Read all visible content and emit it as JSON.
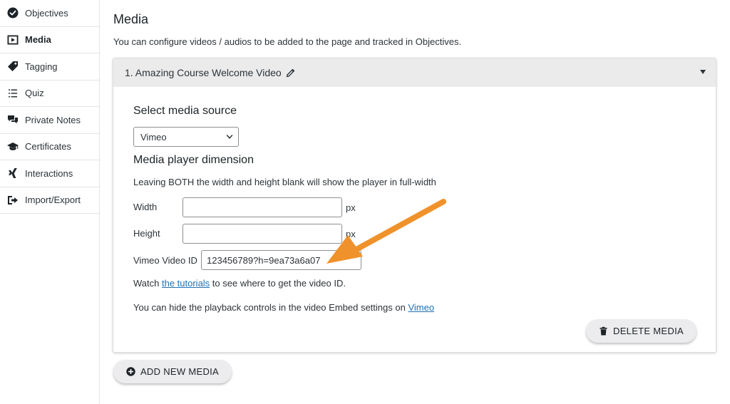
{
  "sidebar": {
    "items": [
      {
        "label": "Objectives",
        "icon": "check-circle-icon",
        "active": false
      },
      {
        "label": "Media",
        "icon": "video-play-icon",
        "active": true
      },
      {
        "label": "Tagging",
        "icon": "tag-icon",
        "active": false
      },
      {
        "label": "Quiz",
        "icon": "list-icon",
        "active": false
      },
      {
        "label": "Private Notes",
        "icon": "comments-icon",
        "active": false
      },
      {
        "label": "Certificates",
        "icon": "graduation-cap-icon",
        "active": false
      },
      {
        "label": "Interactions",
        "icon": "xing-icon",
        "active": false
      },
      {
        "label": "Import/Export",
        "icon": "sign-out-icon",
        "active": false
      }
    ]
  },
  "main": {
    "title": "Media",
    "description": "You can configure videos / audios to be added to the page and tracked in Objectives."
  },
  "panel": {
    "header": "1. Amazing Course Welcome Video",
    "source_title": "Select media source",
    "source_value": "Vimeo",
    "dimension_title": "Media player dimension",
    "dimension_hint": "Leaving BOTH the width and height blank will show the player in full-width",
    "width_label": "Width",
    "width_value": "",
    "height_label": "Height",
    "height_value": "",
    "unit": "px",
    "video_id_label": "Vimeo Video ID",
    "video_id_value": "123456789?h=9ea73a6a07",
    "watch_prefix": "Watch ",
    "watch_link": "the tutorials",
    "watch_suffix": " to see where to get the video ID.",
    "hide_prefix": "You can hide the playback controls in the video Embed settings on ",
    "hide_link": "Vimeo",
    "delete_label": "DELETE MEDIA"
  },
  "add_label": "ADD NEW MEDIA",
  "colors": {
    "accent_arrow": "#f0922b",
    "link": "#2271b1",
    "header_bg": "#ebebec"
  }
}
